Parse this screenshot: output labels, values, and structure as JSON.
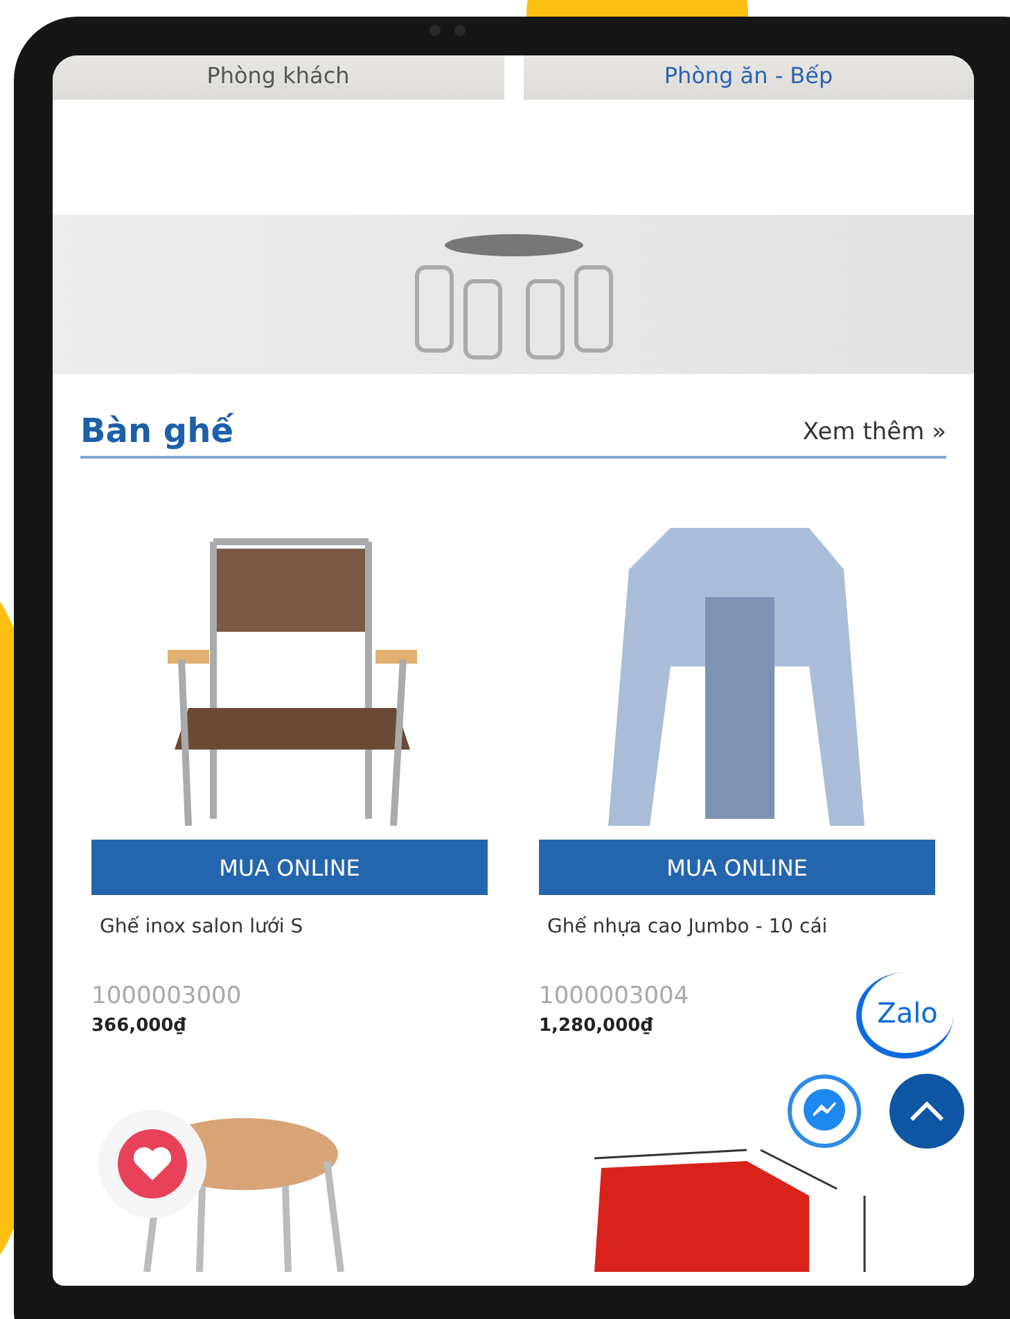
{
  "category_tiles": [
    {
      "label": "Phòng khách",
      "selected": false
    },
    {
      "label": "Phòng ăn - Bếp",
      "selected": true
    }
  ],
  "section": {
    "title": "Bàn ghế",
    "more_link": "Xem thêm »"
  },
  "products": [
    {
      "kind": "chair",
      "button": "MUA ONLINE",
      "name": "Ghế inox salon lưới S",
      "code": "1000003000",
      "price": "366,000₫"
    },
    {
      "kind": "stool",
      "button": "MUA ONLINE",
      "name": "Ghế nhựa cao Jumbo - 10 cái",
      "code": "1000003004",
      "price": "1,280,000₫"
    }
  ],
  "zalo_button": {
    "label": "Zalo"
  }
}
